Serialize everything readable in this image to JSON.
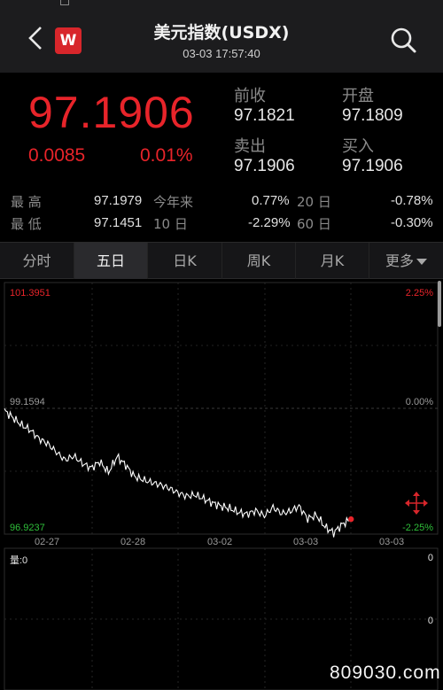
{
  "header": {
    "logo_text": "W",
    "title": "美元指数(USDX)",
    "datetime": "03-03 17:57:40"
  },
  "quote": {
    "price": "97.1906",
    "change": "0.0085",
    "change_pct": "0.01%",
    "prev_close_label": "前收",
    "prev_close": "97.1821",
    "open_label": "开盘",
    "open": "97.1809",
    "ask_label": "卖出",
    "ask": "97.1906",
    "bid_label": "买入",
    "bid": "97.1906"
  },
  "stats": {
    "high_label": "最  高",
    "high": "97.1979",
    "low_label": "最  低",
    "low": "97.1451",
    "ytd_label": "今年来",
    "ytd": "0.77%",
    "d20_label": "20  日",
    "d20": "-0.78%",
    "d10_label": "10  日",
    "d10": "-2.29%",
    "d60_label": "60  日",
    "d60": "-0.30%"
  },
  "tabs": [
    {
      "label": "分时",
      "active": false
    },
    {
      "label": "五日",
      "active": true
    },
    {
      "label": "日K",
      "active": false
    },
    {
      "label": "周K",
      "active": false
    },
    {
      "label": "月K",
      "active": false
    },
    {
      "label": "更多",
      "active": false
    }
  ],
  "chart_data": {
    "type": "line",
    "y_axis_left": [
      "101.3951",
      "99.1594",
      "96.9237"
    ],
    "y_axis_right": [
      "2.25%",
      "0.00%",
      "-2.25%"
    ],
    "ylim": [
      96.9237,
      101.3951
    ],
    "x_labels": [
      "02-27",
      "02-28",
      "03-02",
      "03-03",
      "03-03"
    ],
    "volume_label": "量:0",
    "volume_right_top": "0",
    "volume_right_bottom": "0",
    "series": [
      {
        "x": [
          0,
          2,
          4,
          6,
          8,
          10,
          12,
          14,
          16,
          18,
          20,
          22,
          24,
          26,
          28,
          30,
          32,
          34,
          36,
          38,
          40,
          42,
          44,
          46,
          48,
          50,
          52,
          54,
          56,
          58,
          60,
          62,
          64,
          66,
          68,
          70,
          72,
          74,
          76,
          78,
          80
        ],
        "values": [
          99.12,
          98.99,
          98.86,
          98.77,
          98.62,
          98.53,
          98.38,
          98.24,
          98.31,
          98.18,
          98.1,
          98.21,
          98.02,
          98.3,
          98.15,
          97.95,
          97.89,
          97.84,
          97.8,
          97.74,
          97.66,
          97.6,
          97.62,
          97.55,
          97.48,
          97.42,
          97.38,
          97.31,
          97.28,
          97.34,
          97.25,
          97.4,
          97.29,
          97.33,
          97.42,
          97.2,
          97.26,
          97.05,
          96.95,
          97.1,
          97.19
        ]
      }
    ],
    "colors": {
      "line": "#ffffff",
      "end_dot": "#e8242a",
      "up": "#e8242a",
      "down": "#2fbf3a",
      "neutral": "#9a9a9a"
    }
  },
  "watermark": "809030.com"
}
